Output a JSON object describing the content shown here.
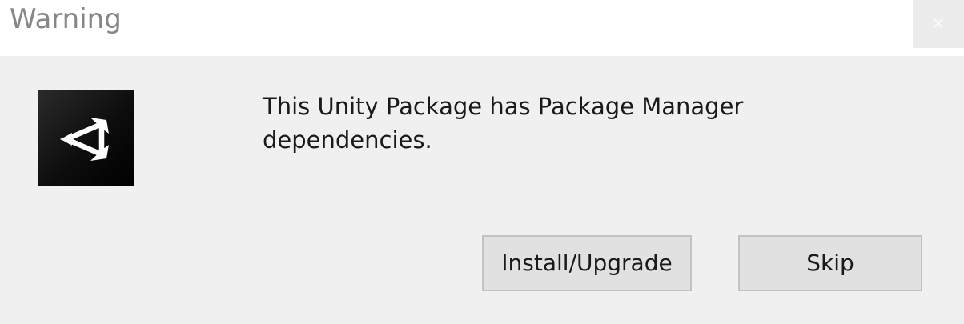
{
  "window": {
    "title": "Warning",
    "close_label": "×"
  },
  "logo": {
    "icon": "unity-logo-icon"
  },
  "message": {
    "text": "This Unity Package has Package Manager dependencies."
  },
  "buttons": {
    "install_label": "Install/Upgrade",
    "skip_label": "Skip"
  },
  "colors": {
    "title_text": "#868686",
    "dialog_bg": "#f0f0f0",
    "button_bg": "#e1e1e1",
    "button_border": "#c2c2c2"
  }
}
